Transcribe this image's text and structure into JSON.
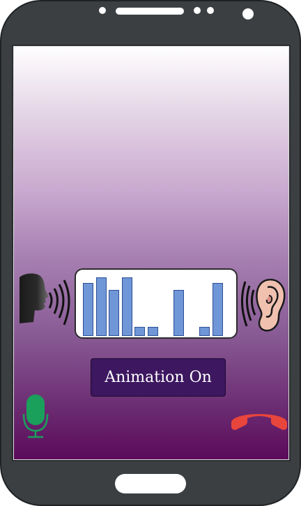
{
  "animation_button": {
    "label": "Animation On"
  },
  "waveform": {
    "levels": [
      0.9,
      1.0,
      0.78,
      1.0,
      0.15,
      0.15,
      0,
      0.78,
      0,
      0.15,
      0.9
    ]
  },
  "colors": {
    "phone_body": "#3b3f42",
    "bar_fill": "#6f96d6",
    "mic": "#1aa05a",
    "hangup": "#e8453c",
    "button_bg": "#3d1760"
  },
  "icons": [
    "speaker-head-icon",
    "ear-icon",
    "microphone-icon",
    "hang-up-icon"
  ]
}
